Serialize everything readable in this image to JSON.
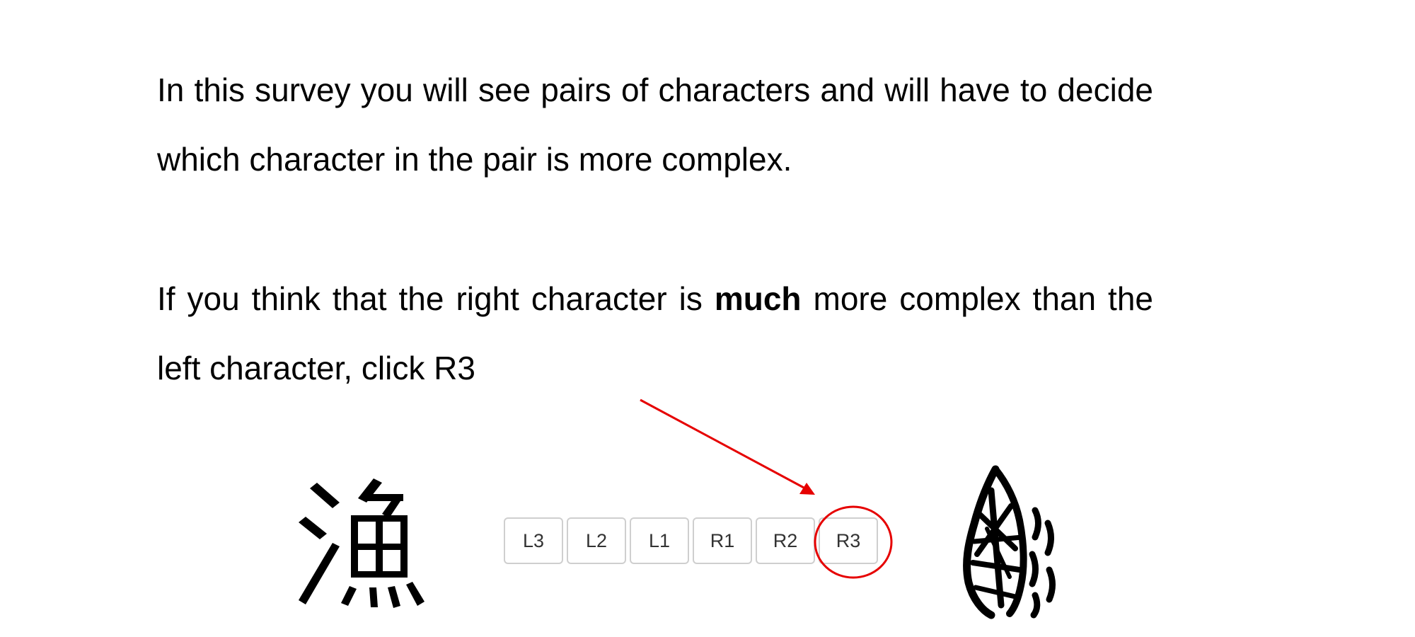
{
  "instructions": {
    "para1": "In this survey you will see pairs of characters and will have to decide which character in the pair is more complex.",
    "para2_before": "If you think that the right character is ",
    "para2_bold": "much",
    "para2_after": " more complex than the left character, click R3"
  },
  "left_character": "漁",
  "scale": {
    "buttons": [
      "L3",
      "L2",
      "L1",
      "R1",
      "R2",
      "R3"
    ],
    "highlighted": "R3"
  },
  "colors": {
    "annotation": "#e60000",
    "button_border": "#cfcfcf",
    "button_text": "#333333"
  }
}
